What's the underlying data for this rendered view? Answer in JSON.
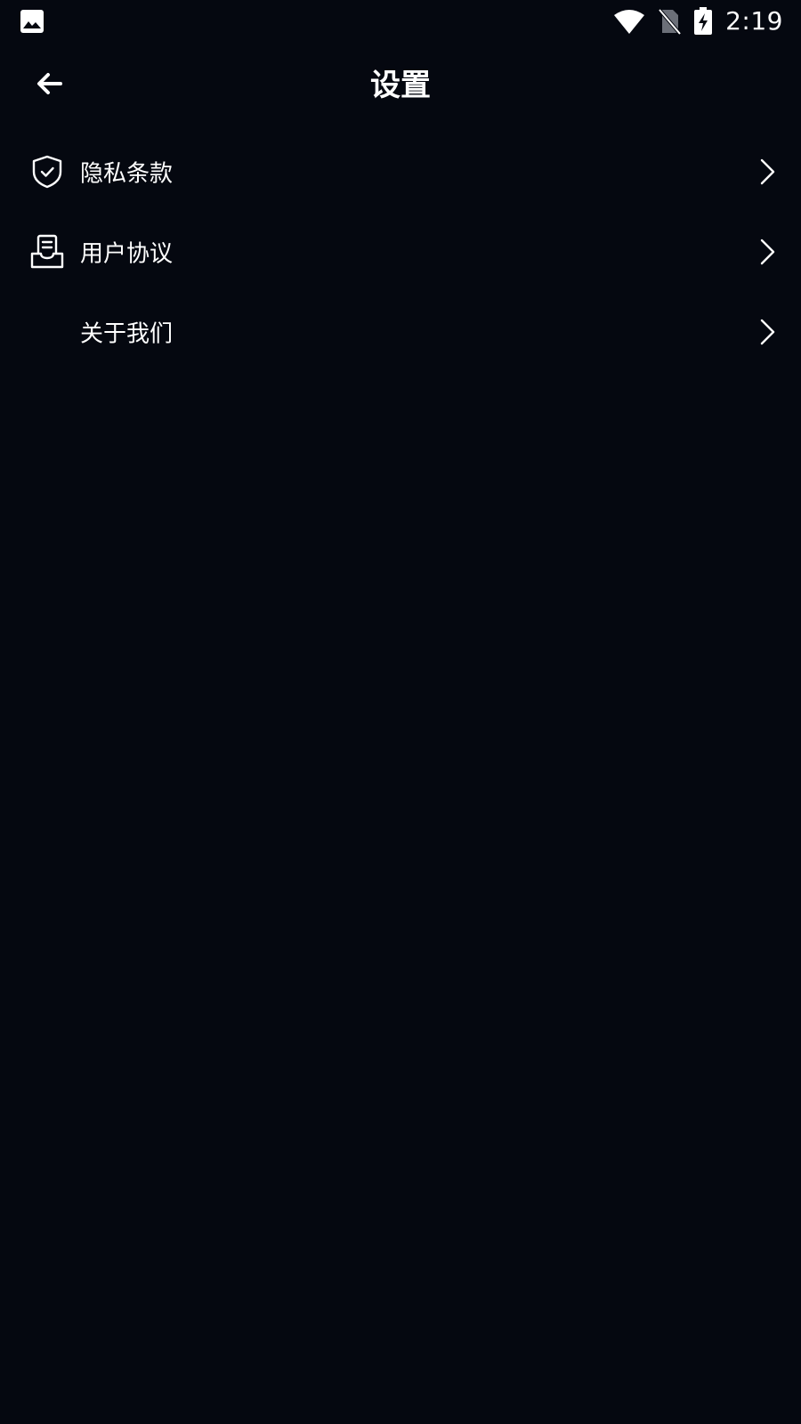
{
  "status_bar": {
    "time": "2:19",
    "left_icon": "image-icon",
    "icons": [
      "wifi-icon",
      "no-sim-icon",
      "battery-charging-icon"
    ]
  },
  "app_bar": {
    "title": "设置",
    "back_icon": "arrow-left-icon"
  },
  "settings": {
    "items": [
      {
        "label": "隐私条款",
        "icon": "shield-check-icon"
      },
      {
        "label": "用户协议",
        "icon": "document-icon"
      },
      {
        "label": "关于我们",
        "icon": ""
      }
    ]
  },
  "colors": {
    "background": "#050810",
    "text": "#ffffff"
  }
}
